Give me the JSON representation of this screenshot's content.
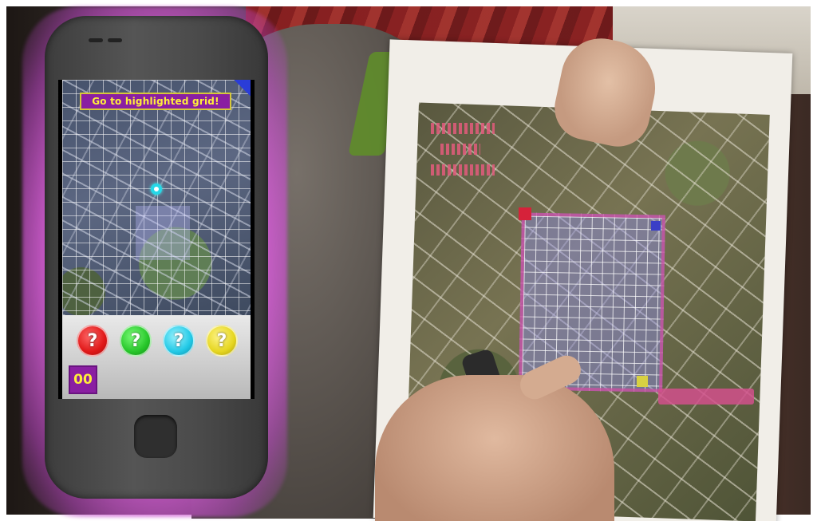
{
  "game": {
    "banner_text": "Go to highlighted grid!",
    "score": "00"
  },
  "answer_buttons": [
    {
      "label": "?",
      "color": "#e01818"
    },
    {
      "label": "?",
      "color": "#27c62a"
    },
    {
      "label": "?",
      "color": "#22c9e6"
    },
    {
      "label": "?",
      "color": "#e6d620"
    }
  ],
  "colors": {
    "phone_glow": "#d660d6",
    "banner_bg": "#8a1fa2",
    "banner_text": "#ffef3a",
    "target_marker": "#25d8e8"
  }
}
